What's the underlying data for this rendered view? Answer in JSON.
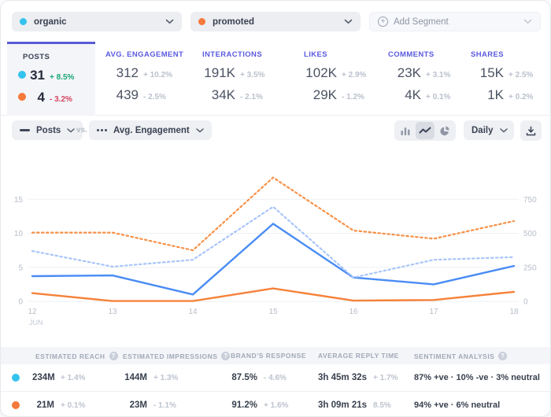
{
  "colors": {
    "organic_dot": "#35c3ee",
    "promoted_dot": "#f4793b",
    "accent_purple": "#5a5cd8",
    "green": "#17a673",
    "red": "#d5455f"
  },
  "segments": {
    "organic_label": "organic",
    "promoted_label": "promoted",
    "add_label": "Add Segment"
  },
  "stats": {
    "columns": [
      {
        "label": "POSTS",
        "selected": true,
        "rows": [
          {
            "value": "31",
            "change": "+ 8.5%",
            "dir": "up"
          },
          {
            "value": "4",
            "change": "- 3.2%",
            "dir": "down"
          }
        ]
      },
      {
        "label": "AVG. ENGAGEMENT",
        "rows": [
          {
            "value": "312",
            "change": "+ 10.2%"
          },
          {
            "value": "439",
            "change": "- 2.5%"
          }
        ]
      },
      {
        "label": "INTERACTIONS",
        "rows": [
          {
            "value": "191K",
            "change": "+ 3.5%"
          },
          {
            "value": "34K",
            "change": "- 2.1%"
          }
        ]
      },
      {
        "label": "LIKES",
        "rows": [
          {
            "value": "102K",
            "change": "+ 2.9%"
          },
          {
            "value": "29K",
            "change": "- 1.2%"
          }
        ]
      },
      {
        "label": "COMMENTS",
        "rows": [
          {
            "value": "23K",
            "change": "+ 3.1%"
          },
          {
            "value": "4K",
            "change": "+ 0.1%"
          }
        ]
      },
      {
        "label": "SHARES",
        "rows": [
          {
            "value": "15K",
            "change": "+ 2.5%"
          },
          {
            "value": "1K",
            "change": "+ 0.2%"
          }
        ]
      }
    ]
  },
  "controls": {
    "metric_a": "Posts",
    "vs_label": "vs.",
    "metric_b": "Avg. Engagement",
    "interval": "Daily"
  },
  "chart_data": {
    "type": "line",
    "x": [
      "12",
      "13",
      "14",
      "15",
      "16",
      "17",
      "18"
    ],
    "x_month": "JUN",
    "left_axis": {
      "label": "Posts",
      "ticks": [
        0,
        5,
        10,
        15
      ],
      "max": 20
    },
    "right_axis": {
      "label": "Avg. Engagement",
      "ticks": [
        0,
        250,
        500,
        750
      ],
      "max": 1000
    },
    "grid": true,
    "series": [
      {
        "name": "Posts - organic",
        "axis": "left",
        "style": "solid",
        "color": "#4a8cf5",
        "values": [
          3.7,
          3.8,
          1,
          11.4,
          3.5,
          2.5,
          5.2
        ]
      },
      {
        "name": "Posts - promoted",
        "axis": "left",
        "style": "solid",
        "color": "#f5823a",
        "values": [
          1.2,
          0.05,
          0.05,
          1.9,
          0.1,
          0.2,
          1.4
        ]
      },
      {
        "name": "Avg. Engagement - organic",
        "axis": "right",
        "style": "dashed",
        "color": "#a8c5f9",
        "values": [
          370,
          255,
          305,
          695,
          175,
          305,
          325
        ]
      },
      {
        "name": "Avg. Engagement - promoted",
        "axis": "right",
        "style": "dashed",
        "color": "#f79046",
        "values": [
          505,
          505,
          375,
          910,
          520,
          460,
          590
        ]
      }
    ]
  },
  "table": {
    "headers": [
      {
        "label": "ESTIMATED REACH",
        "info": true
      },
      {
        "label": "ESTIMATED IMPRESSIONS",
        "info": true
      },
      {
        "label": "BRAND'S RESPONSE",
        "info": false
      },
      {
        "label": "AVERAGE REPLY TIME",
        "info": false
      },
      {
        "label": "SENTIMENT ANALYSIS",
        "info": true
      }
    ],
    "rows": [
      {
        "reach": "234M",
        "reach_chg": "+ 1.4%",
        "impressions": "144M",
        "impressions_chg": "+ 1.3%",
        "brand_response": "87.5%",
        "brand_response_chg": "- 4.6%",
        "reply_time": "3h 45m 32s",
        "reply_time_chg": "+ 1.7%",
        "sentiment": "87% +ve   ·   10% -ve   ·   3% neutral"
      },
      {
        "reach": "21M",
        "reach_chg": "+ 0.1%",
        "impressions": "23M",
        "impressions_chg": "- 1.1%",
        "brand_response": "91.2%",
        "brand_response_chg": "+ 1.6%",
        "reply_time": "3h 09m 21s",
        "reply_time_chg": "8.5%",
        "sentiment": "94% +ve   ·   6% neutral"
      }
    ]
  }
}
